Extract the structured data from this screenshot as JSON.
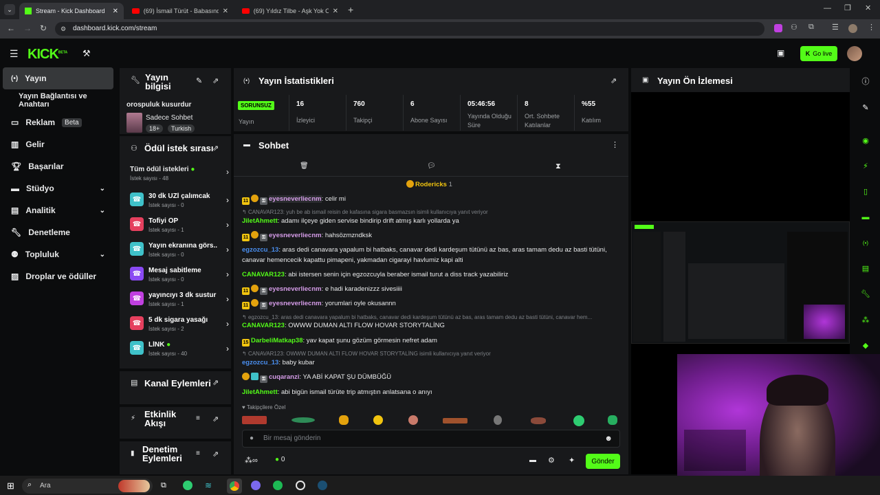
{
  "browser": {
    "tabs": [
      {
        "label": "Stream - Kick Dashboard"
      },
      {
        "label": "(69) İsmail Türüt - Babasından Ha"
      },
      {
        "label": "(69) Yıldız Tilbe - Aşk Yok Olmak"
      }
    ],
    "url": "dashboard.kick.com/stream"
  },
  "header": {
    "logo": "KICK",
    "logo_sup": "BETA",
    "go_live": "Go live"
  },
  "sidebar": {
    "items": [
      {
        "label": "Yayın"
      },
      {
        "label": "Yayın Bağlantısı ve Anahtarı"
      },
      {
        "label": "Reklam",
        "badge": "Beta"
      },
      {
        "label": "Gelir"
      },
      {
        "label": "Başarılar"
      },
      {
        "label": "Stüdyo"
      },
      {
        "label": "Analitik"
      },
      {
        "label": "Denetleme"
      },
      {
        "label": "Topluluk"
      },
      {
        "label": "Droplar ve ödüller"
      }
    ]
  },
  "stream_info": {
    "title": "Yayın bilgisi",
    "stream_title": "orospuluk kusurdur",
    "category": "Sadece Sohbet",
    "tags": [
      "18+",
      "Turkish"
    ]
  },
  "rewards": {
    "title": "Ödül istek sırası",
    "all_label": "Tüm ödül istekleri",
    "all_count": "İstek sayısı - 48",
    "items": [
      {
        "label": "30 dk UZİ çalımcak",
        "count": "İstek sayısı - 0",
        "color": "#3fc1c9"
      },
      {
        "label": "Tofiyi ÖP",
        "count": "İstek sayısı - 1",
        "color": "#e5405e"
      },
      {
        "label": "Yayın ekranına görs...",
        "count": "İstek sayısı - 0",
        "color": "#3fc1c9"
      },
      {
        "label": "Mesaj sabitleme",
        "count": "İstek sayısı - 0",
        "color": "#8a4af3"
      },
      {
        "label": "yayıncıyı 3 dk sustur",
        "count": "İstek sayısı - 1",
        "color": "#c040e0"
      },
      {
        "label": "5 dk sigara yasağı",
        "count": "İstek sayısı - 2",
        "color": "#e5405e"
      },
      {
        "label": "LİNK",
        "count": "İstek sayısı - 40",
        "color": "#3fc1c9"
      }
    ]
  },
  "channel_actions": {
    "title": "Kanal Eylemleri"
  },
  "activity": {
    "title": "Etkinlik Akışı"
  },
  "moderation": {
    "title": "Denetim Eylemleri"
  },
  "stats": {
    "title": "Yayın İstatistikleri",
    "status_badge": "SORUNSUZ",
    "status_label": "Yayın",
    "items": [
      {
        "value": "16",
        "label": "İzleyici"
      },
      {
        "value": "760",
        "label": "Takipçi"
      },
      {
        "value": "6",
        "label": "Abone Sayısı"
      },
      {
        "value": "05:46:56",
        "label": "Yayında Olduğu Süre"
      },
      {
        "value": "8",
        "label": "Ort. Sohbete Katılanlar"
      },
      {
        "value": "%55",
        "label": "Katılım"
      }
    ]
  },
  "chat": {
    "title": "Sohbet",
    "pinned_user": "Rodericks",
    "pinned_count": "1",
    "messages": [
      {
        "user": "eyesneverliecnm",
        "text": ": celir mi",
        "color": "#d59ce8"
      },
      {
        "reply": "CANAVAR123: yuh be ab ismail reisin de kafasına sigara basmazsın isimli kullanıcıya yanıt veriyor"
      },
      {
        "user": "JiletAhmett",
        "text": ": adamı ilçeye giden servise bindirip drift atmış karlı yollarda ya",
        "color": "#53fc18"
      },
      {
        "user": "eyesneverliecnm",
        "text": ": hahsözmzndksk",
        "color": "#d59ce8"
      },
      {
        "user": "egzozcu_13",
        "text": ": aras dedi canavara yapalum bi hatbaks, canavar dedi kardeşum tütünü az bas, aras tamam dedu az basti tütüni, canavar hemencecik kapattu pimapeni, yakmadan cigarayi havlumiz kapi alti",
        "color": "#4a8ff0"
      },
      {
        "user": "CANAVAR123",
        "text": ": abi istersen senin için egzozcuyla beraber ismail turut a diss track yazabiliriz",
        "color": "#53fc18"
      },
      {
        "user": "eyesneverliecnm",
        "text": ": e hadi karadenizzz sivesiiii",
        "color": "#d59ce8"
      },
      {
        "user": "eyesneverliecnm",
        "text": ": yorumlari oyle okusannn",
        "color": "#d59ce8"
      },
      {
        "reply": "egzozcu_13: aras dedi canavara yapalum bi hatbaks, canavar dedi kardeşum tütünü az bas, aras tamam dedu az basti tütüni, canavar hem..."
      },
      {
        "user": "CANAVAR123",
        "text": ": OWWW DUMAN ALTI FLOW HOVAR STORYTALİNG",
        "color": "#53fc18"
      },
      {
        "user": "DarbeliMatkap38",
        "text": ": yav kapat şunu gözüm görmesin nefret adam",
        "color": "#53fc18"
      },
      {
        "reply": "CANAVAR123: OWWW DUMAN ALTI FLOW HOVAR STORYTALİNG isimli kullanıcıya yanıt veriyor"
      },
      {
        "user": "egzozcu_13",
        "text": ": baby kubar",
        "color": "#4a8ff0"
      },
      {
        "user": "cuqaranzi",
        "text": ": YA ABİ KAPAT ŞU DÜMBÜĞÜ",
        "color": "#d59ce8"
      },
      {
        "user": "JiletAhmett",
        "text": ": abi bigün ismail türüte trip atmıştın anlatsana o anıyı",
        "color": "#53fc18"
      }
    ],
    "emote_label": "Takipçilere Özel",
    "input_placeholder": "Bir mesaj gönderin",
    "points": "0",
    "send_label": "Gönder",
    "badge_11": "11",
    "badge_15": "15"
  },
  "preview": {
    "title": "Yayın Ön İzlemesi"
  },
  "taskbar": {
    "search": "Ara"
  }
}
